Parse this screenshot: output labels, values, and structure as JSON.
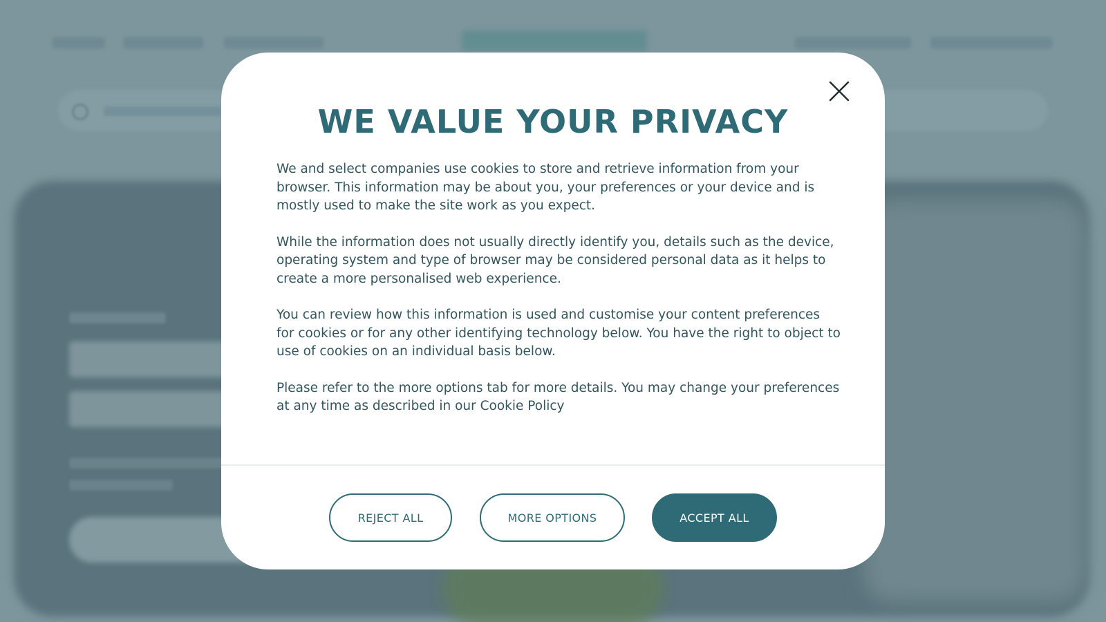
{
  "consent_dialog": {
    "title": "WE VALUE YOUR PRIVACY",
    "paragraphs": [
      "We and select companies use cookies to store and retrieve information from your browser. This information may be about you, your preferences or your device and is mostly used to make the site work as you expect.",
      "While the information does not usually directly identify you, details such as the device, operating system and type of browser may be considered personal data as it helps to create a more personalised web experience.",
      "You can review how this information is used and customise your content preferences for cookies or for any other identifying technology below. You have the right to object to use of cookies on an individual basis below.",
      "Please refer to the more options tab for more details. You may change your preferences at any time as described in our Cookie Policy"
    ],
    "buttons": {
      "reject_label": "REJECT ALL",
      "more_label": "MORE OPTIONS",
      "accept_label": "ACCEPT ALL"
    },
    "close_icon": "close-icon"
  },
  "colors": {
    "accent": "#2f6b76",
    "overlay": "#7d959d",
    "body_text": "#33555e"
  }
}
